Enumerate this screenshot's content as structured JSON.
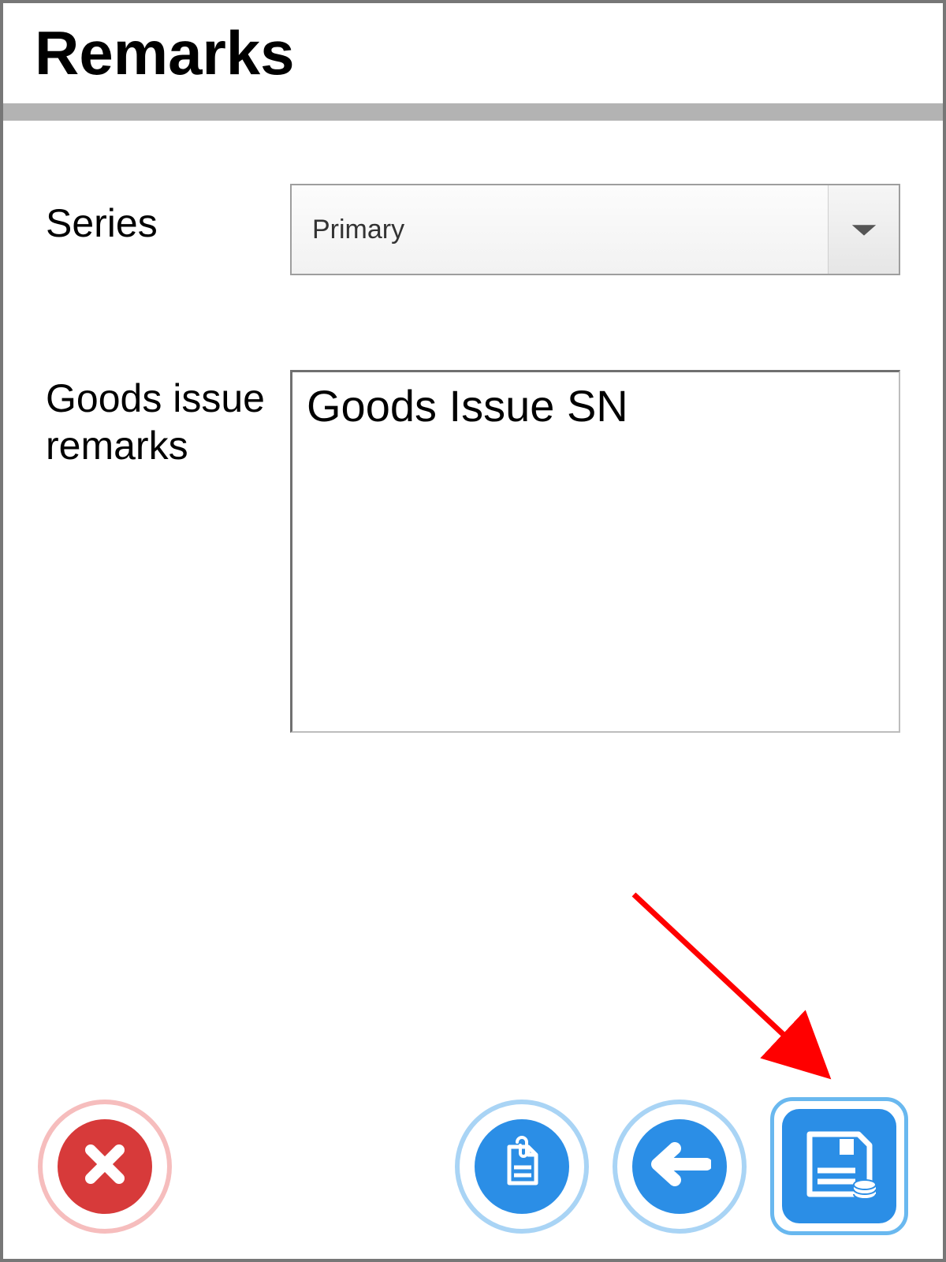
{
  "header": {
    "title": "Remarks"
  },
  "form": {
    "series": {
      "label": "Series",
      "value": "Primary"
    },
    "remarks": {
      "label": "Goods issue remarks",
      "value": "Goods Issue SN"
    }
  },
  "annotation": {
    "arrow_target": "save-button"
  },
  "colors": {
    "cancel": "#d73a3a",
    "primary": "#2b8ee6",
    "arrow": "#ff0000"
  }
}
